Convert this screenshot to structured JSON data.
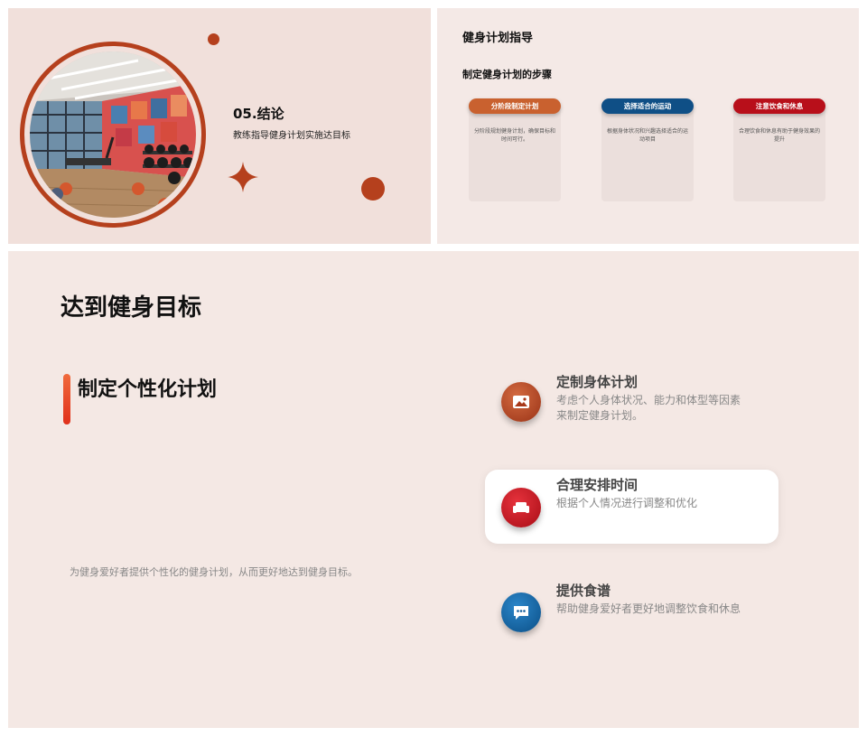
{
  "slide1": {
    "title": "05.结论",
    "subtitle": "教练指导健身计划实施达目标",
    "image": "gym-interior-photo"
  },
  "slide2": {
    "title": "健身计划指导",
    "subtitle": "制定健身计划的步骤",
    "steps": [
      {
        "label": "分阶段制定计划",
        "text": "分阶段规划健身计划，确保目标和时间可行。",
        "color": "#c9612f"
      },
      {
        "label": "选择适合的运动",
        "text": "根据身体状况和兴趣选择适合的运动项目",
        "color": "#0f4f86"
      },
      {
        "label": "注意饮食和休息",
        "text": "合理饮食和休息有助于健身效果的提升",
        "color": "#b80f1a"
      }
    ]
  },
  "slide3": {
    "title": "达到健身目标",
    "subtitle": "制定个性化计划",
    "description": "为健身爱好者提供个性化的健身计划，从而更好地达到健身目标。",
    "features": [
      {
        "title": "定制身体计划",
        "desc_line1": "考虑个人身体状况、能力和体型等因素",
        "desc_line2": "来制定健身计划。",
        "icon": "image-icon",
        "color": "#a8391a"
      },
      {
        "title": "合理安排时间",
        "desc_line1": "根据个人情况进行调整和优化",
        "desc_line2": "",
        "icon": "sofa-icon",
        "color": "#c41421"
      },
      {
        "title": "提供食谱",
        "desc_line1": "帮助健身爱好者更好地调整饮食和休息",
        "desc_line2": "",
        "icon": "chat-icon",
        "color": "#0f5c9b"
      }
    ]
  }
}
